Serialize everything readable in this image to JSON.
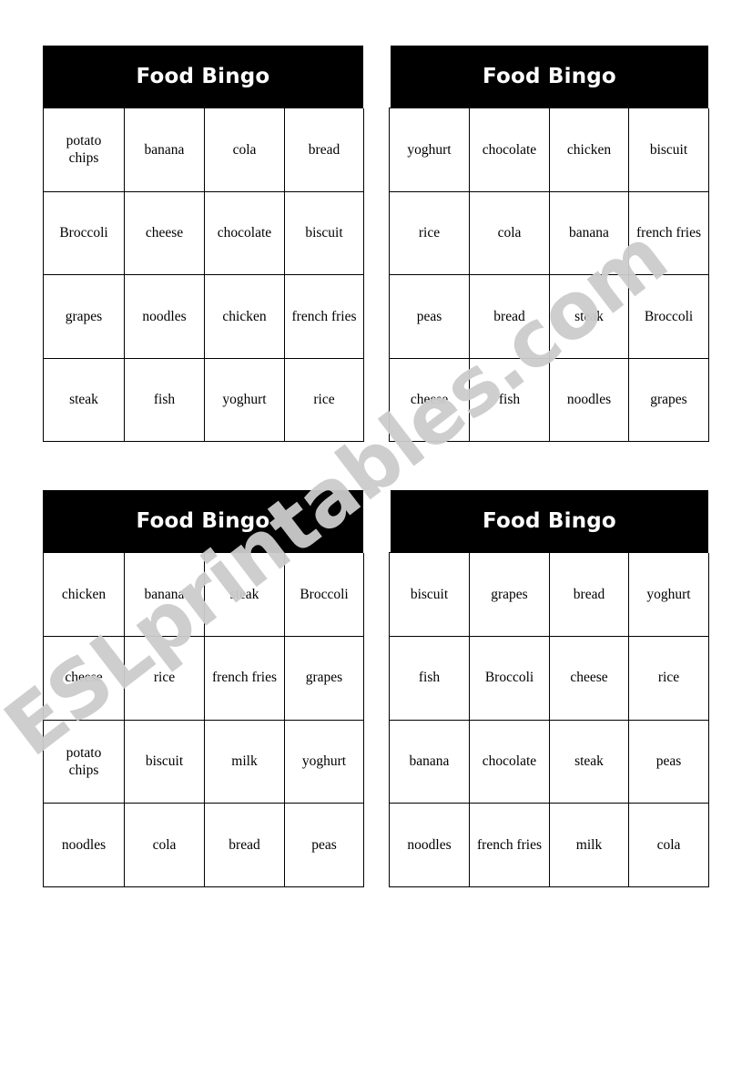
{
  "page": {
    "title": "Food Bingo worksheet",
    "background_color": "#ffffff"
  },
  "watermark": {
    "text": "ESLprintables.com",
    "color": "#cccccc",
    "rotation_deg": -37.5
  },
  "cards": [
    {
      "id": "card-1",
      "title": "Food Bingo",
      "rows": [
        [
          "potato chips",
          "banana",
          "cola",
          "bread"
        ],
        [
          "Broccoli",
          "cheese",
          "chocolate",
          "biscuit"
        ],
        [
          "grapes",
          "noodles",
          "chicken",
          "french fries"
        ],
        [
          "steak",
          "fish",
          "yoghurt",
          "rice"
        ]
      ]
    },
    {
      "id": "card-2",
      "title": "Food Bingo",
      "rows": [
        [
          "yoghurt",
          "chocolate",
          "chicken",
          "biscuit"
        ],
        [
          "rice",
          "cola",
          "banana",
          "french fries"
        ],
        [
          "peas",
          "bread",
          "steak",
          "Broccoli"
        ],
        [
          "cheese",
          "fish",
          "noodles",
          "grapes"
        ]
      ]
    },
    {
      "id": "card-3",
      "title": "Food Bingo",
      "rows": [
        [
          "chicken",
          "banana",
          "steak",
          "Broccoli"
        ],
        [
          "cheese",
          "rice",
          "french fries",
          "grapes"
        ],
        [
          "potato chips",
          "biscuit",
          "milk",
          "yoghurt"
        ],
        [
          "noodles",
          "cola",
          "bread",
          "peas"
        ]
      ]
    },
    {
      "id": "card-4",
      "title": "Food Bingo",
      "rows": [
        [
          "biscuit",
          "grapes",
          "bread",
          "yoghurt"
        ],
        [
          "fish",
          "Broccoli",
          "cheese",
          "rice"
        ],
        [
          "banana",
          "chocolate",
          "steak",
          "peas"
        ],
        [
          "noodles",
          "french fries",
          "milk",
          "cola"
        ]
      ]
    }
  ]
}
